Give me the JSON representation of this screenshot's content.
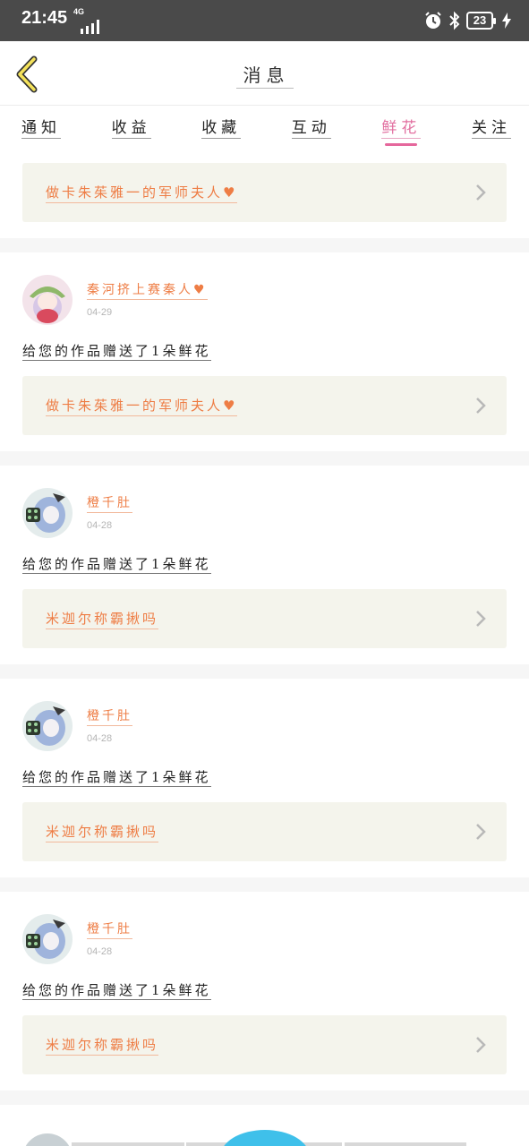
{
  "status_bar": {
    "time": "21:45",
    "network": "4G",
    "battery": "23"
  },
  "header": {
    "title": "消息",
    "back_icon": "chevron-left-icon"
  },
  "tabs": [
    {
      "label": "通知",
      "active": false
    },
    {
      "label": "收益",
      "active": false
    },
    {
      "label": "收藏",
      "active": false
    },
    {
      "label": "互动",
      "active": false
    },
    {
      "label": "鲜花",
      "active": true
    },
    {
      "label": "关注",
      "active": false
    }
  ],
  "colors": {
    "accent": "#e5679c",
    "link_text": "#ee7d45",
    "card_bg": "#f4f4ec",
    "fab": "#3fc0ea"
  },
  "first_card": {
    "link": "做卡朱茱雅一的军师夫人♥"
  },
  "items": [
    {
      "username": "秦河挤上赛秦人♥",
      "date": "04-29",
      "message": "给您的作品赠送了1朵鲜花",
      "link": "做卡朱茱雅一的军师夫人♥",
      "avatar": "avatar-girl-green-hat"
    },
    {
      "username": "橙千肚",
      "date": "04-28",
      "message": "给您的作品赠送了1朵鲜花",
      "link": "米迦尔称霸揪吗",
      "avatar": "avatar-girl-blue-hair"
    },
    {
      "username": "橙千肚",
      "date": "04-28",
      "message": "给您的作品赠送了1朵鲜花",
      "link": "米迦尔称霸揪吗",
      "avatar": "avatar-girl-blue-hair"
    },
    {
      "username": "橙千肚",
      "date": "04-28",
      "message": "给您的作品赠送了1朵鲜花",
      "link": "米迦尔称霸揪吗",
      "avatar": "avatar-girl-blue-hair"
    }
  ]
}
